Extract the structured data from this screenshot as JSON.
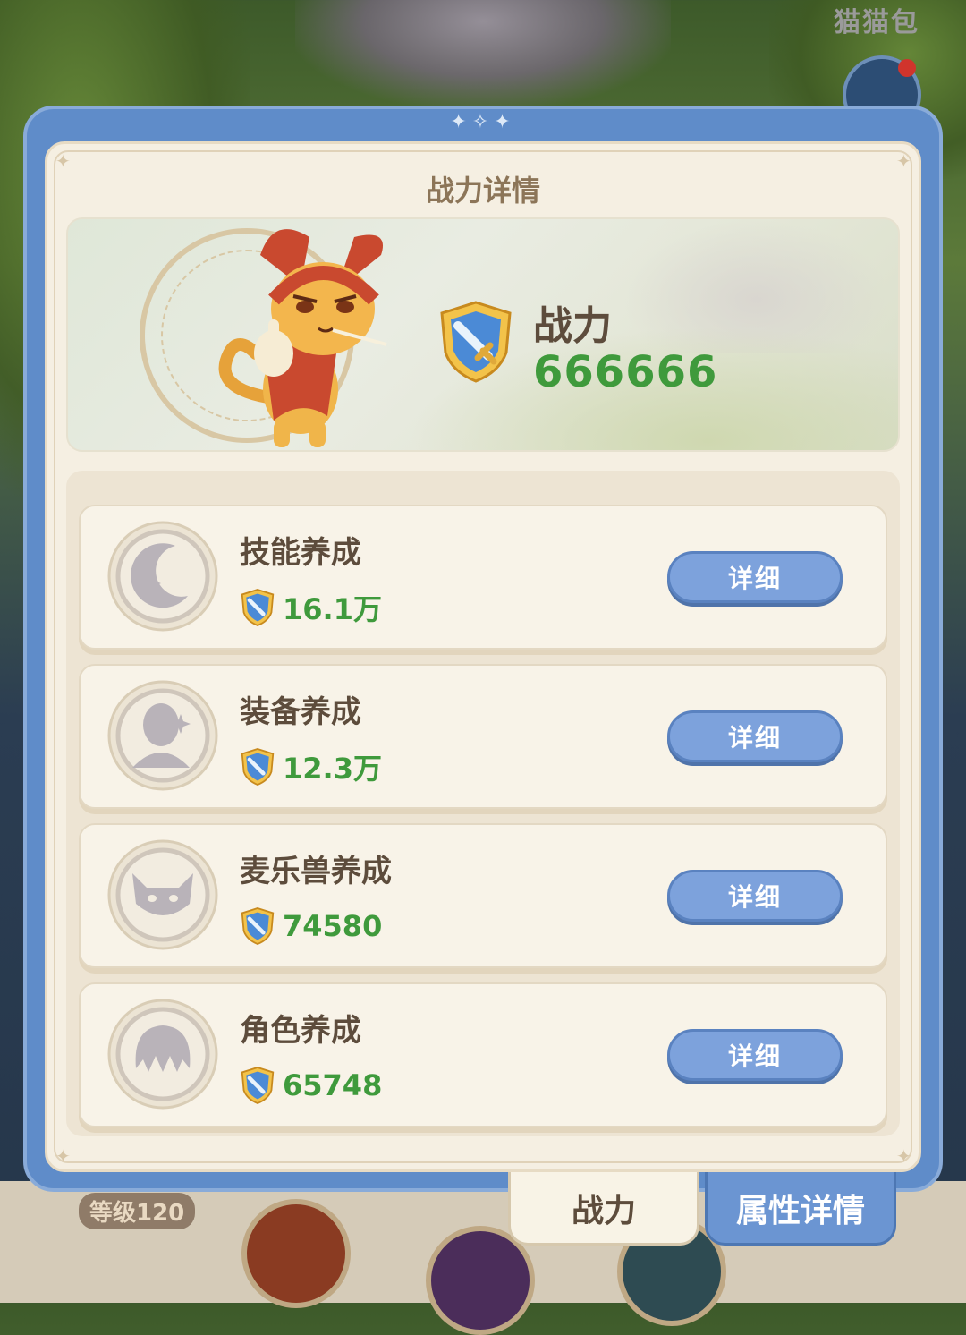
{
  "background": {
    "top_right_label": "猫猫包",
    "level_badge": "等级120"
  },
  "panel": {
    "title": "战力详情",
    "power_label": "战力",
    "power_value": "666666"
  },
  "items": [
    {
      "name": "技能养成",
      "value": "16.1万",
      "button": "详细",
      "icon": "moon-star-icon"
    },
    {
      "name": "装备养成",
      "value": "12.3万",
      "button": "详细",
      "icon": "hooded-figure-icon"
    },
    {
      "name": "麦乐兽养成",
      "value": "74580",
      "button": "详细",
      "icon": "fox-face-icon"
    },
    {
      "name": "角色养成",
      "value": "65748",
      "button": "详细",
      "icon": "character-hair-icon"
    }
  ],
  "tabs": [
    {
      "label": "战力",
      "active": true
    },
    {
      "label": "属性详情",
      "active": false
    }
  ],
  "colors": {
    "accent_blue": "#5f8cc9",
    "power_green": "#3f9a3c",
    "panel_cream": "#f5efe2",
    "text_brown": "#5d4c3c"
  }
}
